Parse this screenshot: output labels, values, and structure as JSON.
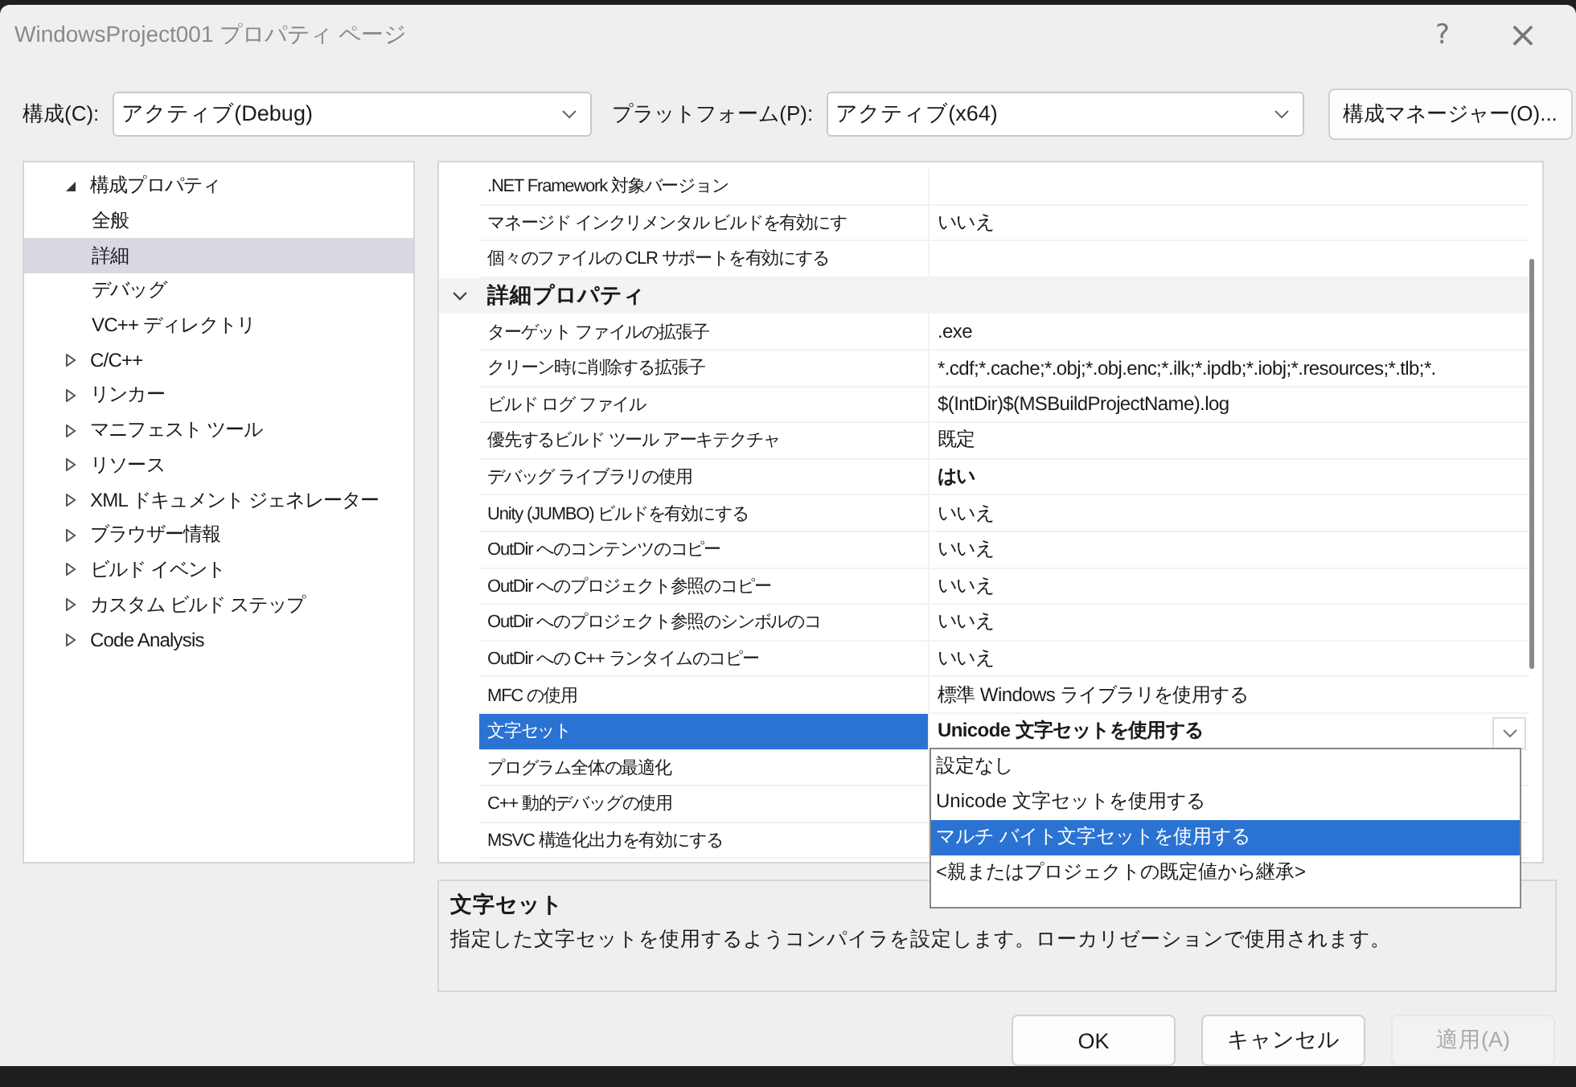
{
  "window": {
    "title": "WindowsProject001 プロパティ ページ",
    "help": "?",
    "close": "×"
  },
  "config": {
    "label": "構成(C):",
    "value": "アクティブ(Debug)"
  },
  "platform": {
    "label": "プラットフォーム(P):",
    "value": "アクティブ(x64)"
  },
  "config_manager_button": "構成マネージャー(O)...",
  "tree": [
    {
      "label": "構成プロパティ",
      "expanded": true,
      "selected": false,
      "children": [
        {
          "label": "全般",
          "selected": false
        },
        {
          "label": "詳細",
          "selected": true
        },
        {
          "label": "デバッグ",
          "selected": false
        },
        {
          "label": "VC++ ディレクトリ",
          "selected": false
        }
      ]
    },
    {
      "label": "C/C++",
      "expanded": false,
      "selected": false
    },
    {
      "label": "リンカー",
      "expanded": false,
      "selected": false
    },
    {
      "label": "マニフェスト ツール",
      "expanded": false,
      "selected": false
    },
    {
      "label": "リソース",
      "expanded": false,
      "selected": false
    },
    {
      "label": "XML ドキュメント ジェネレーター",
      "expanded": false,
      "selected": false
    },
    {
      "label": "ブラウザー情報",
      "expanded": false,
      "selected": false
    },
    {
      "label": "ビルド イベント",
      "expanded": false,
      "selected": false
    },
    {
      "label": "カスタム ビルド ステップ",
      "expanded": false,
      "selected": false
    },
    {
      "label": "Code Analysis",
      "expanded": false,
      "selected": false
    }
  ],
  "properties": [
    {
      "kind": "property",
      "name": ".NET Framework 対象バージョン",
      "selected": false
    },
    {
      "kind": "property",
      "name": "マネージド インクリメンタル ビルドを有効にす",
      "value": "いいえ",
      "bold": false,
      "selected": false
    },
    {
      "kind": "property",
      "name": "個々のファイルの CLR サポートを有効にする",
      "selected": false
    },
    {
      "kind": "section",
      "name": "詳細プロパティ",
      "expanded": true
    },
    {
      "kind": "property",
      "name": "ターゲット ファイルの拡張子",
      "value": ".exe",
      "bold": false,
      "selected": false
    },
    {
      "kind": "property",
      "name": "クリーン時に削除する拡張子",
      "value": "*.cdf;*.cache;*.obj;*.obj.enc;*.ilk;*.ipdb;*.iobj;*.resources;*.tlb;*.",
      "bold": false,
      "selected": false
    },
    {
      "kind": "property",
      "name": "ビルド ログ ファイル",
      "value": "$(IntDir)$(MSBuildProjectName).log",
      "bold": false,
      "selected": false
    },
    {
      "kind": "property",
      "name": "優先するビルド ツール アーキテクチャ",
      "value": "既定",
      "bold": false,
      "selected": false
    },
    {
      "kind": "property",
      "name": "デバッグ ライブラリの使用",
      "value": "はい",
      "bold": true,
      "selected": false
    },
    {
      "kind": "property",
      "name": "Unity (JUMBO) ビルドを有効にする",
      "value": "いいえ",
      "bold": false,
      "selected": false
    },
    {
      "kind": "property",
      "name": "OutDir へのコンテンツのコピー",
      "value": "いいえ",
      "bold": false,
      "selected": false
    },
    {
      "kind": "property",
      "name": "OutDir へのプロジェクト参照のコピー",
      "value": "いいえ",
      "bold": false,
      "selected": false
    },
    {
      "kind": "property",
      "name": "OutDir へのプロジェクト参照のシンボルのコ",
      "value": "いいえ",
      "bold": false,
      "selected": false
    },
    {
      "kind": "property",
      "name": "OutDir への C++ ランタイムのコピー",
      "value": "いいえ",
      "bold": false,
      "selected": false
    },
    {
      "kind": "property",
      "name": "MFC の使用",
      "value": "標準 Windows ライブラリを使用する",
      "bold": false,
      "selected": false
    },
    {
      "kind": "property",
      "name": "文字セット",
      "value": "Unicode 文字セットを使用する",
      "bold": true,
      "selected": true,
      "dropdown": {
        "open": true,
        "options": [
          {
            "label": "設定なし",
            "selected": false
          },
          {
            "label": "Unicode 文字セットを使用する",
            "selected": false
          },
          {
            "label": "マルチ バイト文字セットを使用する",
            "selected": true
          },
          {
            "label": "<親またはプロジェクトの既定値から継承>",
            "selected": false
          }
        ]
      }
    },
    {
      "kind": "property",
      "name": "プログラム全体の最適化",
      "selected": false
    },
    {
      "kind": "property",
      "name": "C++ 動的デバッグの使用",
      "selected": false
    },
    {
      "kind": "property",
      "name": "MSVC 構造化出力を有効にする",
      "selected": false
    }
  ],
  "description": {
    "title": "文字セット",
    "text": "指定した文字セットを使用するようコンパイラを設定します。ローカリゼーションで使用されます。"
  },
  "buttons": [
    {
      "label": "OK",
      "disabled": false
    },
    {
      "label": "キャンセル",
      "disabled": false
    },
    {
      "label": "適用(A)",
      "disabled": true
    }
  ]
}
